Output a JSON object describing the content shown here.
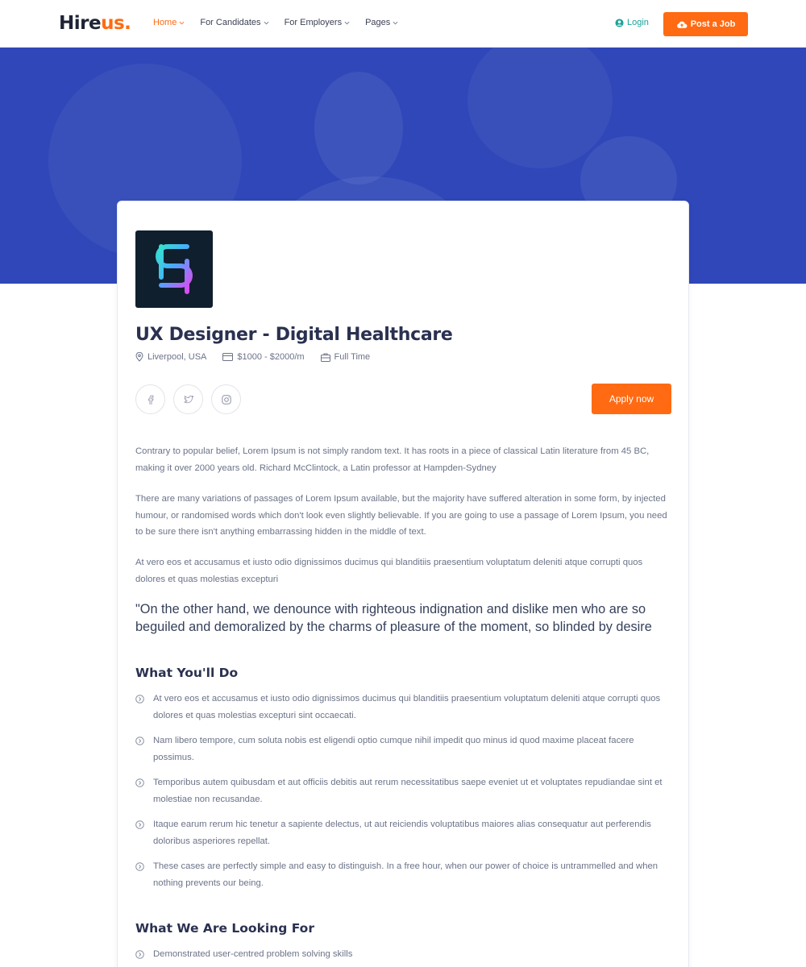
{
  "header": {
    "logo_main": "Hire",
    "logo_accent": "us.",
    "nav": [
      {
        "label": "Home"
      },
      {
        "label": "For Candidates"
      },
      {
        "label": "For Employers"
      },
      {
        "label": "Pages"
      }
    ],
    "login_label": "Login",
    "post_job_label": "Post a Job"
  },
  "colors": {
    "accent": "#ff6a13",
    "hero": "#2f47b8",
    "login": "#1aa39a"
  },
  "job": {
    "title": "UX Designer - Digital Healthcare",
    "location": "Liverpool, USA",
    "salary": "$1000 - $2000/m",
    "type": "Full Time",
    "apply_label": "Apply now",
    "social_icons": [
      "facebook-icon",
      "twitter-icon",
      "instagram-icon"
    ]
  },
  "description": {
    "p1": "Contrary to popular belief, Lorem Ipsum is not simply random text. It has roots in a piece of classical Latin literature from 45 BC, making it over 2000 years old. Richard McClintock, a Latin professor at Hampden-Sydney",
    "p2": "There are many variations of passages of Lorem Ipsum available, but the majority have suffered alteration in some form, by injected humour, or randomised words which don't look even slightly believable. If you are going to use a passage of Lorem Ipsum, you need to be sure there isn't anything embarrassing hidden in the middle of text.",
    "p3": "At vero eos et accusamus et iusto odio dignissimos ducimus qui blanditiis praesentium voluptatum deleniti atque corrupti quos dolores et quas molestias excepturi",
    "quote": "\"On the other hand, we denounce with righteous indignation and dislike men who are so beguiled and demoralized by the charms of pleasure of the moment, so blinded by desire"
  },
  "what_youll_do": {
    "title": "What You'll Do",
    "items": [
      "At vero eos et accusamus et iusto odio dignissimos ducimus qui blanditiis praesentium voluptatum deleniti atque corrupti quos dolores et quas molestias excepturi sint occaecati.",
      "Nam libero tempore, cum soluta nobis est eligendi optio cumque nihil impedit quo minus id quod maxime placeat facere possimus.",
      "Temporibus autem quibusdam et aut officiis debitis aut rerum necessitatibus saepe eveniet ut et voluptates repudiandae sint et molestiae non recusandae.",
      "Itaque earum rerum hic tenetur a sapiente delectus, ut aut reiciendis voluptatibus maiores alias consequatur aut perferendis doloribus asperiores repellat.",
      "These cases are perfectly simple and easy to distinguish. In a free hour, when our power of choice is untrammelled and when nothing prevents our being."
    ]
  },
  "looking_for": {
    "title": "What We Are Looking For",
    "items": [
      "Demonstrated user-centred problem solving skills"
    ]
  }
}
